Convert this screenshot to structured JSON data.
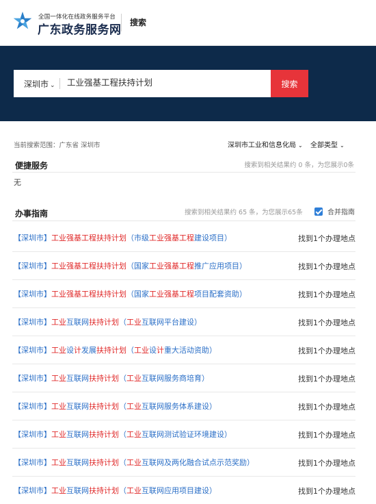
{
  "header": {
    "logo_subtitle": "全国一体化在线政务服务平台",
    "logo_title": "广东政务服务网",
    "search_label": "搜索"
  },
  "search": {
    "region": "深圳市",
    "query": "工业强基工程扶持计划",
    "button": "搜索"
  },
  "scope": {
    "text": "当前搜索范围：广东省 深圳市",
    "department_filter": "深圳市工业和信息化局",
    "type_filter": "全部类型"
  },
  "convenience": {
    "title": "便捷服务",
    "count_text": "搜索到相关结果约 0 条，为您展示0条",
    "empty_text": "无"
  },
  "guide": {
    "title": "办事指南",
    "count_text": "搜索到相关结果约 65 条，为您展示65条",
    "merge_label": "合并指南",
    "merge_checked": true,
    "items": [
      {
        "title": "【深圳市】工业强基工程扶持计划（市级工业强基工程建设项目）",
        "location": "找到1个办理地点"
      },
      {
        "title": "【深圳市】工业强基工程扶持计划（国家工业强基工程推广应用项目）",
        "location": "找到1个办理地点"
      },
      {
        "title": "【深圳市】工业强基工程扶持计划（国家工业强基工程项目配套资助）",
        "location": "找到1个办理地点"
      },
      {
        "title": "【深圳市】工业互联网扶持计划（工业互联网平台建设）",
        "location": "找到1个办理地点"
      },
      {
        "title": "【深圳市】工业设计发展扶持计划（工业设计重大活动资助）",
        "location": "找到1个办理地点"
      },
      {
        "title": "【深圳市】工业互联网扶持计划（工业互联网服务商培育）",
        "location": "找到1个办理地点"
      },
      {
        "title": "【深圳市】工业互联网扶持计划（工业互联网服务体系建设）",
        "location": "找到1个办理地点"
      },
      {
        "title": "【深圳市】工业互联网扶持计划（工业互联网测试验证环境建设）",
        "location": "找到1个办理地点"
      },
      {
        "title": "【深圳市】工业互联网扶持计划（工业互联网及两化融合试点示范奖励）",
        "location": "找到1个办理地点"
      },
      {
        "title": "【深圳市】工业互联网扶持计划（工业互联网应用项目建设）",
        "location": "找到1个办理地点"
      }
    ]
  },
  "colors": {
    "hero_bg": "#0d2a4a",
    "search_button": "#e7343a",
    "link_blue": "#2b6fc7",
    "highlight_red": "#e02a2a",
    "logo_blue": "#2b7fc9"
  },
  "icons": {
    "logo": "guangdong-gov-star-logo-icon",
    "dropdown": "chevron-down-icon",
    "checkbox": "checkbox-checked-icon"
  }
}
